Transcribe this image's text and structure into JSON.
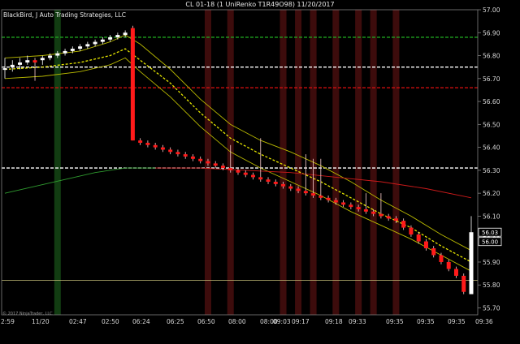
{
  "window": {
    "title": "CL 01-18 (1 UniRenko T1R49O98)  11/20/2017"
  },
  "chart_data": {
    "type": "candlestick",
    "subtitle": "BlackBird, J Auto Trading Strategies, LLC",
    "copyright": "© 2017 NinjaTrader, LLC",
    "y_ticks": [
      "57.00",
      "56.90",
      "56.80",
      "56.70",
      "56.60",
      "56.50",
      "56.40",
      "56.30",
      "56.20",
      "56.10",
      "56.00",
      "55.90",
      "55.80",
      "55.70"
    ],
    "y_range": [
      55.67,
      57.0
    ],
    "x_ticks": [
      "2:59",
      "11/20",
      "02:47",
      "02:50",
      "06:24",
      "06:25",
      "06:50",
      "08:00",
      "08:00",
      "09:03",
      "09:17",
      "09:18",
      "09:33",
      "09:35",
      "09:35",
      "09:35",
      "09:36"
    ],
    "current_price": "56.03",
    "price_badges": [
      "56.00"
    ],
    "horizontal_levels": [
      {
        "price": 56.88,
        "color": "#1fa31f",
        "style": "dashed"
      },
      {
        "price": 56.75,
        "color": "#ffffff",
        "style": "dashed"
      },
      {
        "price": 56.66,
        "color": "#e01010",
        "style": "dashed"
      },
      {
        "price": 56.31,
        "color": "#ffffff",
        "style": "dashed"
      },
      {
        "price": 55.82,
        "color": "#c9c27a",
        "style": "solid"
      }
    ],
    "green_zone_bar": 7,
    "red_zone_bars": [
      27,
      30,
      37,
      39,
      41,
      44,
      47,
      49,
      52
    ],
    "bar_count": 63,
    "bars": [
      {
        "o": 56.74,
        "c": 56.745,
        "h": 56.79,
        "l": 56.7
      },
      {
        "o": 56.75,
        "c": 56.76,
        "h": 56.78,
        "l": 56.73
      },
      {
        "o": 56.76,
        "c": 56.77,
        "h": 56.79,
        "l": 56.74
      },
      {
        "o": 56.77,
        "c": 56.78,
        "h": 56.8,
        "l": 56.76
      },
      {
        "o": 56.78,
        "c": 56.77,
        "h": 56.79,
        "l": 56.69
      },
      {
        "o": 56.78,
        "c": 56.79,
        "h": 56.8,
        "l": 56.76
      },
      {
        "o": 56.79,
        "c": 56.8,
        "h": 56.81,
        "l": 56.78
      },
      {
        "o": 56.8,
        "c": 56.81,
        "h": 56.82,
        "l": 56.79
      },
      {
        "o": 56.81,
        "c": 56.82,
        "h": 56.83,
        "l": 56.8
      },
      {
        "o": 56.82,
        "c": 56.83,
        "h": 56.84,
        "l": 56.81
      },
      {
        "o": 56.83,
        "c": 56.84,
        "h": 56.85,
        "l": 56.82
      },
      {
        "o": 56.84,
        "c": 56.85,
        "h": 56.86,
        "l": 56.83
      },
      {
        "o": 56.85,
        "c": 56.86,
        "h": 56.87,
        "l": 56.84
      },
      {
        "o": 56.86,
        "c": 56.87,
        "h": 56.88,
        "l": 56.85
      },
      {
        "o": 56.87,
        "c": 56.88,
        "h": 56.89,
        "l": 56.86
      },
      {
        "o": 56.88,
        "c": 56.89,
        "h": 56.9,
        "l": 56.87
      },
      {
        "o": 56.89,
        "c": 56.9,
        "h": 56.91,
        "l": 56.88
      },
      {
        "o": 56.92,
        "c": 56.43,
        "h": 56.93,
        "l": 56.43
      },
      {
        "o": 56.43,
        "c": 56.42,
        "h": 56.44,
        "l": 56.41
      },
      {
        "o": 56.42,
        "c": 56.41,
        "h": 56.43,
        "l": 56.4
      },
      {
        "o": 56.41,
        "c": 56.4,
        "h": 56.42,
        "l": 56.39
      },
      {
        "o": 56.4,
        "c": 56.39,
        "h": 56.41,
        "l": 56.38
      },
      {
        "o": 56.39,
        "c": 56.38,
        "h": 56.4,
        "l": 56.37
      },
      {
        "o": 56.38,
        "c": 56.37,
        "h": 56.39,
        "l": 56.36
      },
      {
        "o": 56.37,
        "c": 56.36,
        "h": 56.38,
        "l": 56.35
      },
      {
        "o": 56.36,
        "c": 56.35,
        "h": 56.37,
        "l": 56.34
      },
      {
        "o": 56.35,
        "c": 56.34,
        "h": 56.36,
        "l": 56.33
      },
      {
        "o": 56.34,
        "c": 56.33,
        "h": 56.35,
        "l": 56.32
      },
      {
        "o": 56.33,
        "c": 56.32,
        "h": 56.34,
        "l": 56.31
      },
      {
        "o": 56.32,
        "c": 56.31,
        "h": 56.33,
        "l": 56.3
      },
      {
        "o": 56.31,
        "c": 56.3,
        "h": 56.41,
        "l": 56.29
      },
      {
        "o": 56.3,
        "c": 56.29,
        "h": 56.31,
        "l": 56.28
      },
      {
        "o": 56.29,
        "c": 56.28,
        "h": 56.3,
        "l": 56.27
      },
      {
        "o": 56.28,
        "c": 56.27,
        "h": 56.29,
        "l": 56.26
      },
      {
        "o": 56.27,
        "c": 56.26,
        "h": 56.44,
        "l": 56.25
      },
      {
        "o": 56.26,
        "c": 56.25,
        "h": 56.27,
        "l": 56.24
      },
      {
        "o": 56.25,
        "c": 56.24,
        "h": 56.26,
        "l": 56.23
      },
      {
        "o": 56.24,
        "c": 56.23,
        "h": 56.25,
        "l": 56.22
      },
      {
        "o": 56.23,
        "c": 56.22,
        "h": 56.24,
        "l": 56.21
      },
      {
        "o": 56.22,
        "c": 56.21,
        "h": 56.23,
        "l": 56.2
      },
      {
        "o": 56.21,
        "c": 56.2,
        "h": 56.37,
        "l": 56.19
      },
      {
        "o": 56.2,
        "c": 56.19,
        "h": 56.35,
        "l": 56.18
      },
      {
        "o": 56.19,
        "c": 56.18,
        "h": 56.35,
        "l": 56.17
      },
      {
        "o": 56.18,
        "c": 56.17,
        "h": 56.19,
        "l": 56.16
      },
      {
        "o": 56.17,
        "c": 56.16,
        "h": 56.18,
        "l": 56.15
      },
      {
        "o": 56.16,
        "c": 56.15,
        "h": 56.17,
        "l": 56.14
      },
      {
        "o": 56.15,
        "c": 56.14,
        "h": 56.16,
        "l": 56.13
      },
      {
        "o": 56.14,
        "c": 56.13,
        "h": 56.15,
        "l": 56.12
      },
      {
        "o": 56.13,
        "c": 56.12,
        "h": 56.2,
        "l": 56.11
      },
      {
        "o": 56.12,
        "c": 56.11,
        "h": 56.13,
        "l": 56.1
      },
      {
        "o": 56.11,
        "c": 56.1,
        "h": 56.2,
        "l": 56.09
      },
      {
        "o": 56.1,
        "c": 56.09,
        "h": 56.11,
        "l": 56.08
      },
      {
        "o": 56.09,
        "c": 56.08,
        "h": 56.1,
        "l": 56.07
      },
      {
        "o": 56.08,
        "c": 56.05,
        "h": 56.09,
        "l": 56.04
      },
      {
        "o": 56.05,
        "c": 56.02,
        "h": 56.06,
        "l": 56.01
      },
      {
        "o": 56.02,
        "c": 55.99,
        "h": 56.03,
        "l": 55.98
      },
      {
        "o": 55.99,
        "c": 55.96,
        "h": 56.0,
        "l": 55.95
      },
      {
        "o": 55.96,
        "c": 55.93,
        "h": 55.97,
        "l": 55.92
      },
      {
        "o": 55.93,
        "c": 55.9,
        "h": 55.94,
        "l": 55.89
      },
      {
        "o": 55.9,
        "c": 55.87,
        "h": 55.91,
        "l": 55.86
      },
      {
        "o": 55.87,
        "c": 55.84,
        "h": 55.88,
        "l": 55.83
      },
      {
        "o": 55.84,
        "c": 55.77,
        "h": 55.85,
        "l": 55.76
      },
      {
        "o": 55.76,
        "c": 56.03,
        "h": 56.1,
        "l": 55.76
      }
    ],
    "indicators": [
      {
        "name": "mid",
        "color": "#e6e600",
        "style": "dashed",
        "points": [
          [
            0,
            56.74
          ],
          [
            5,
            56.75
          ],
          [
            10,
            56.77
          ],
          [
            14,
            56.8
          ],
          [
            16,
            56.83
          ],
          [
            18,
            56.78
          ],
          [
            22,
            56.68
          ],
          [
            26,
            56.55
          ],
          [
            30,
            56.44
          ],
          [
            34,
            56.37
          ],
          [
            38,
            56.31
          ],
          [
            42,
            56.25
          ],
          [
            46,
            56.18
          ],
          [
            50,
            56.11
          ],
          [
            54,
            56.05
          ],
          [
            58,
            55.97
          ],
          [
            62,
            55.9
          ]
        ]
      },
      {
        "name": "upper",
        "color": "#b9b900",
        "style": "solid",
        "points": [
          [
            0,
            56.79
          ],
          [
            5,
            56.8
          ],
          [
            10,
            56.82
          ],
          [
            14,
            56.86
          ],
          [
            16,
            56.89
          ],
          [
            18,
            56.85
          ],
          [
            22,
            56.74
          ],
          [
            26,
            56.61
          ],
          [
            30,
            56.5
          ],
          [
            34,
            56.43
          ],
          [
            38,
            56.38
          ],
          [
            42,
            56.32
          ],
          [
            46,
            56.25
          ],
          [
            50,
            56.17
          ],
          [
            54,
            56.1
          ],
          [
            58,
            56.02
          ],
          [
            62,
            55.95
          ]
        ]
      },
      {
        "name": "lower",
        "color": "#b9b900",
        "style": "solid",
        "points": [
          [
            0,
            56.7
          ],
          [
            5,
            56.71
          ],
          [
            10,
            56.73
          ],
          [
            14,
            56.76
          ],
          [
            16,
            56.79
          ],
          [
            18,
            56.73
          ],
          [
            22,
            56.62
          ],
          [
            26,
            56.49
          ],
          [
            30,
            56.38
          ],
          [
            34,
            56.31
          ],
          [
            38,
            56.25
          ],
          [
            42,
            56.19
          ],
          [
            46,
            56.12
          ],
          [
            50,
            56.06
          ],
          [
            54,
            56.0
          ],
          [
            58,
            55.93
          ],
          [
            62,
            55.86
          ]
        ]
      },
      {
        "name": "trend",
        "color": "#2f9b2f",
        "style": "solid",
        "points": [
          [
            0,
            56.2
          ],
          [
            4,
            56.23
          ],
          [
            8,
            56.26
          ],
          [
            12,
            56.29
          ],
          [
            16,
            56.31
          ],
          [
            20,
            56.31
          ]
        ]
      },
      {
        "name": "trend2",
        "color": "#cc1a1a",
        "style": "solid",
        "points": [
          [
            20,
            56.31
          ],
          [
            26,
            56.31
          ],
          [
            32,
            56.3
          ],
          [
            38,
            56.29
          ],
          [
            44,
            56.27
          ],
          [
            50,
            56.25
          ],
          [
            56,
            56.22
          ],
          [
            62,
            56.18
          ]
        ]
      }
    ]
  }
}
